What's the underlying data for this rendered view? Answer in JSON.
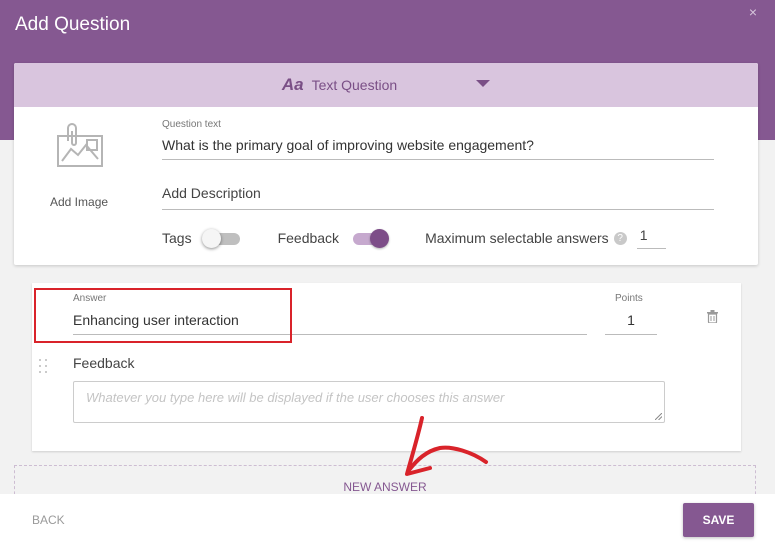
{
  "dialog": {
    "title": "Add Question",
    "close_icon": "×"
  },
  "question_type": {
    "icon_text": "Aa",
    "label": "Text Question"
  },
  "image": {
    "label": "Add Image"
  },
  "question": {
    "label": "Question text",
    "value": "What is the primary goal of improving website engagement?"
  },
  "description": {
    "placeholder": "Add Description"
  },
  "options": {
    "tags_label": "Tags",
    "tags_on": false,
    "feedback_label": "Feedback",
    "feedback_on": true,
    "max_label": "Maximum selectable answers",
    "help_icon": "?",
    "max_value": "1"
  },
  "answer": {
    "label": "Answer",
    "value": "Enhancing user interaction",
    "points_label": "Points",
    "points_value": "1",
    "feedback_label": "Feedback",
    "feedback_placeholder": "Whatever you type here will be displayed if the user chooses this answer"
  },
  "new_answer_label": "NEW ANSWER",
  "footer": {
    "back_label": "BACK",
    "save_label": "SAVE"
  },
  "colors": {
    "accent": "#855891",
    "accent_light": "#d9c5de",
    "highlight_red": "#d9232a"
  }
}
